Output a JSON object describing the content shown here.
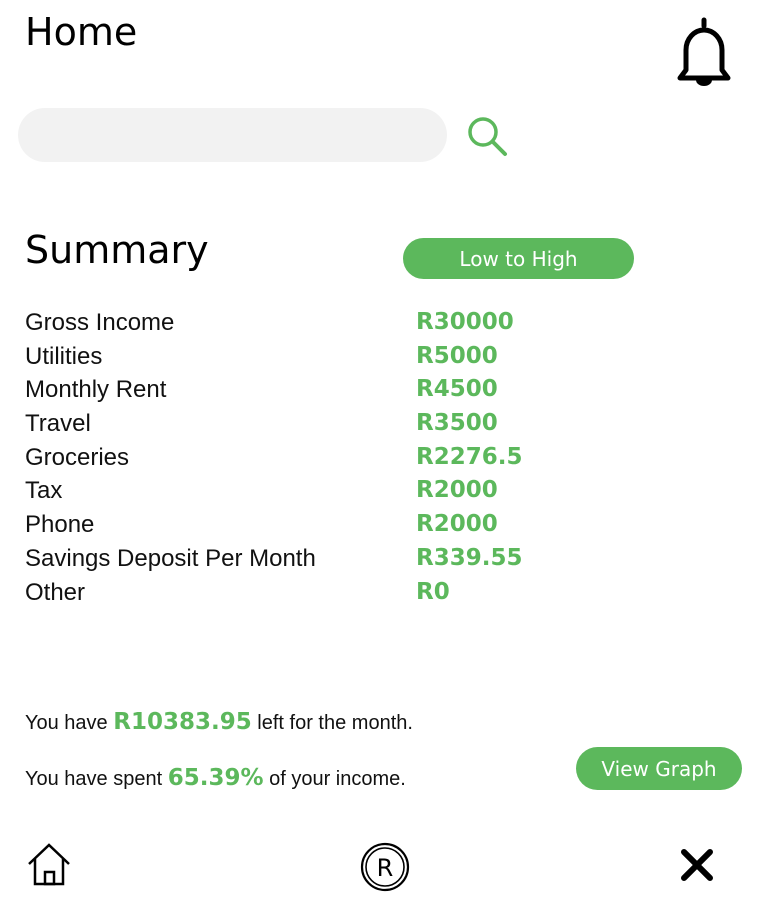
{
  "header": {
    "title": "Home",
    "bell_icon": "bell-icon"
  },
  "search": {
    "value": "",
    "placeholder": "",
    "icon": "search-icon"
  },
  "summary": {
    "title": "Summary",
    "sort_label": "Low to High",
    "rows": [
      {
        "label": "Gross Income",
        "value": "R30000"
      },
      {
        "label": "Utilities",
        "value": "R5000"
      },
      {
        "label": "Monthly Rent",
        "value": "R4500"
      },
      {
        "label": "Travel",
        "value": "R3500"
      },
      {
        "label": "Groceries",
        "value": "R2276.5"
      },
      {
        "label": "Tax",
        "value": "R2000"
      },
      {
        "label": "Phone",
        "value": "R2000"
      },
      {
        "label": "Savings Deposit Per Month",
        "value": "R339.55"
      },
      {
        "label": "Other",
        "value": "R0"
      }
    ]
  },
  "footer_stats": {
    "remaining_prefix": "You have",
    "remaining_amount": "R10383.95",
    "remaining_suffix": "left for the month.",
    "spent_prefix": "You have spent",
    "spent_percent": "65.39%",
    "spent_suffix": "of your income.",
    "graph_label": "View Graph"
  },
  "bottom_nav": {
    "home_icon": "home-icon",
    "r_label": "R",
    "close_icon": "close-icon"
  },
  "colors": {
    "accent": "#5cb85c",
    "search_bg": "#f2f2f2"
  }
}
